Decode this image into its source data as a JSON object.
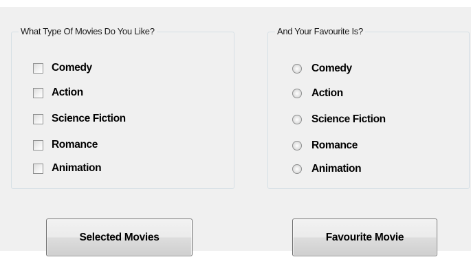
{
  "checkbox_group": {
    "legend": "What Type Of Movies Do You Like?",
    "options": [
      {
        "label": "Comedy",
        "checked": false
      },
      {
        "label": "Action",
        "checked": false
      },
      {
        "label": "Science Fiction",
        "checked": false
      },
      {
        "label": "Romance",
        "checked": false
      },
      {
        "label": "Animation",
        "checked": false
      }
    ]
  },
  "radio_group": {
    "legend": "And Your Favourite Is?",
    "options": [
      {
        "label": "Comedy",
        "selected": false
      },
      {
        "label": "Action",
        "selected": false
      },
      {
        "label": "Science Fiction",
        "selected": false
      },
      {
        "label": "Romance",
        "selected": false
      },
      {
        "label": "Animation",
        "selected": false
      }
    ]
  },
  "buttons": {
    "selected_movies": "Selected Movies",
    "favourite_movie": "Favourite Movie"
  }
}
